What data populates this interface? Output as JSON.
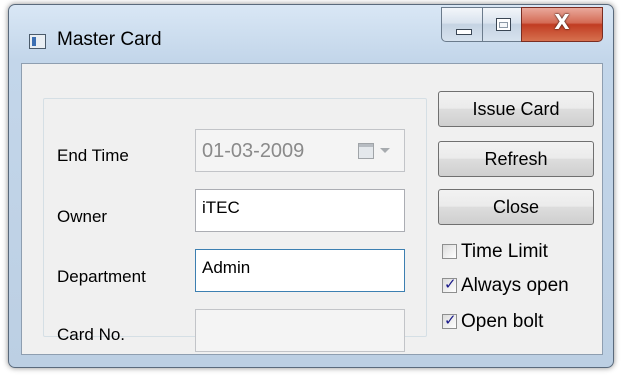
{
  "window": {
    "title": "Master Card",
    "icons": {
      "app": "app-window-icon",
      "minimize": "minimize-icon",
      "maximize": "maximize-icon",
      "close": "close-icon"
    },
    "close_glyph": "X"
  },
  "form": {
    "end_time": {
      "label": "End Time",
      "value": "01-03-2009",
      "enabled": false
    },
    "owner": {
      "label": "Owner",
      "value": "iTEC"
    },
    "department": {
      "label": "Department",
      "value": "Admin"
    },
    "card_no": {
      "label": "Card No.",
      "value": "",
      "enabled": false
    }
  },
  "buttons": {
    "issue_card": "Issue Card",
    "refresh": "Refresh",
    "close": "Close"
  },
  "options": {
    "time_limit": {
      "label": "Time Limit",
      "checked": false
    },
    "always_open": {
      "label": "Always open",
      "checked": true
    },
    "open_bolt": {
      "label": "Open bolt",
      "checked": true
    }
  },
  "colors": {
    "accent": "#3c7fb1",
    "close_button": "#c13c22"
  }
}
